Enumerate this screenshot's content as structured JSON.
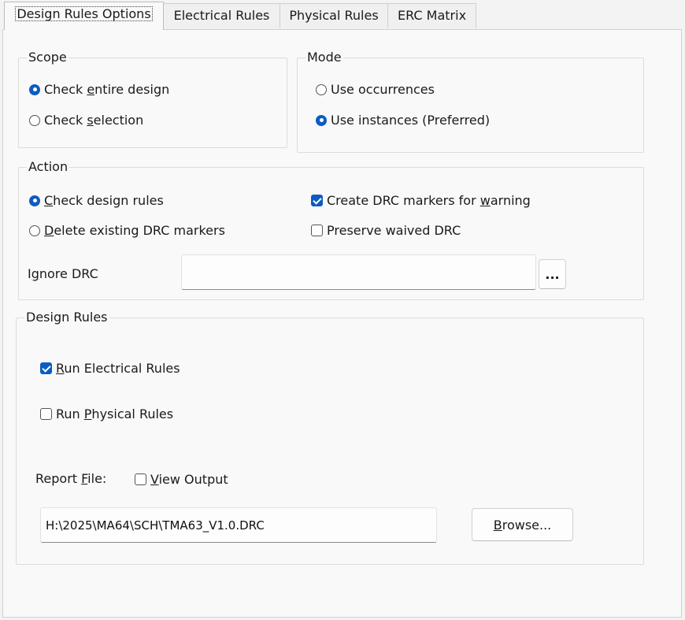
{
  "tabs": [
    {
      "label": "Design Rules Options",
      "active": true
    },
    {
      "label": "Electrical Rules",
      "active": false
    },
    {
      "label": "Physical Rules",
      "active": false
    },
    {
      "label": "ERC Matrix",
      "active": false
    }
  ],
  "scope": {
    "title": "Scope",
    "options": [
      {
        "pre": "Check ",
        "ak": "e",
        "post": "ntire design",
        "selected": true
      },
      {
        "pre": "Check ",
        "ak": "s",
        "post": "election",
        "selected": false
      }
    ]
  },
  "mode": {
    "title": "Mode",
    "options": [
      {
        "pre": "Use occurrences",
        "ak": "",
        "post": "",
        "selected": false
      },
      {
        "pre": "Use instances (Preferred)",
        "ak": "",
        "post": "",
        "selected": true
      }
    ]
  },
  "action": {
    "title": "Action",
    "radios": [
      {
        "pre": "",
        "ak": "C",
        "post": "heck design rules",
        "selected": true
      },
      {
        "pre": "",
        "ak": "D",
        "post": "elete existing DRC markers",
        "selected": false
      }
    ],
    "checks": [
      {
        "pre": "Create DRC markers for ",
        "ak": "w",
        "post": "arning",
        "checked": true
      },
      {
        "pre": "Preserve waived DRC",
        "ak": "",
        "post": "",
        "checked": false
      }
    ],
    "ignore_label_pre": "I",
    "ignore_label_ak": "g",
    "ignore_label_post": "nore DRC",
    "ignore_value": "",
    "ellipsis_label": "..."
  },
  "design_rules": {
    "title": "Design Rules",
    "checks": [
      {
        "pre": "",
        "ak": "R",
        "post": "un Electrical Rules",
        "checked": true
      },
      {
        "pre": "Run ",
        "ak": "P",
        "post": "hysical Rules",
        "checked": false
      }
    ],
    "report_label_pre": "Report ",
    "report_label_ak": "F",
    "report_label_post": "ile:",
    "view_output": {
      "pre": "",
      "ak": "V",
      "post": "iew Output",
      "checked": false
    },
    "report_path": "H:\\2025\\MA64\\SCH\\TMA63_V1.0.DRC",
    "browse_pre": "",
    "browse_ak": "B",
    "browse_post": "rowse..."
  }
}
